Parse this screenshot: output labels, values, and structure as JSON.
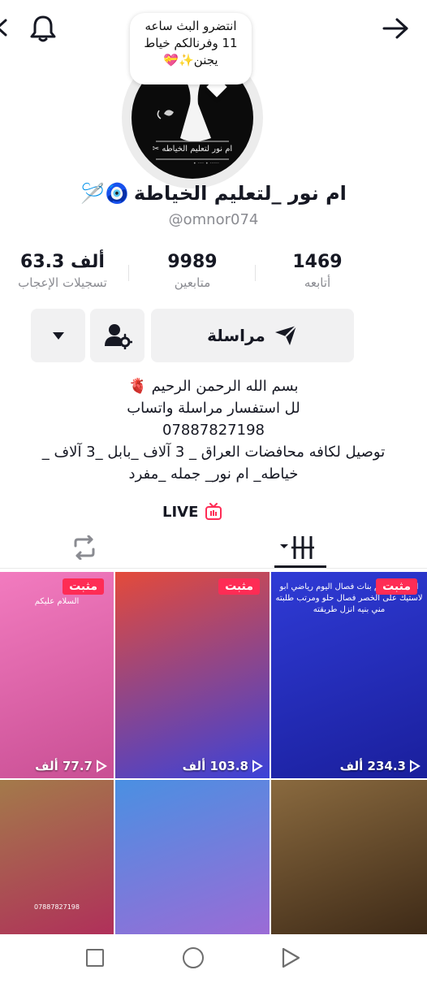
{
  "header": {
    "back_icon": "chevron-left-icon",
    "notifications_icon": "bell-icon",
    "share_icon": "arrow-right-icon"
  },
  "live_bubble": {
    "line1": "انتضرو البث ساعه",
    "line2": "11 وفرنالكم خياط",
    "line3": "يجنن✨💝"
  },
  "avatar_logo": {
    "title": "ام نور لتعليم الخياطه ✂"
  },
  "profile": {
    "name": "ام نور _لتعليم الخياطة",
    "name_emojis": "🧿🪡",
    "username": "@omnor074"
  },
  "stats": {
    "following": {
      "value": "1469",
      "label": "أتابعه"
    },
    "followers": {
      "value": "9989",
      "label": "متابعين"
    },
    "likes": {
      "value": "63.3 ألف",
      "label": "تسجيلات الإعجاب"
    }
  },
  "actions": {
    "message_label": "مراسلة",
    "message_icon": "send-icon",
    "friends_icon": "user-settings-icon",
    "more_icon": "caret-down-icon"
  },
  "bio": {
    "line1": "بسم الله الرحمن الرحيم 🫀",
    "line2": "لل استفسار مراسلة واتساب",
    "line3": "07887827198",
    "line4": "توصيل لكافه محافضات العراق _ 3 آلاف _بابل _3 آلاف _",
    "line5": "خياطه_ ام نور_ جمله _مفرد"
  },
  "live": {
    "label": "LIVE",
    "icon": "tv-icon"
  },
  "tabs": {
    "videos_icon": "grid-sort-icon",
    "reposts_icon": "repost-icon"
  },
  "videos": [
    {
      "pinned": "مثبت",
      "views": "234.3 ألف",
      "caption": "السلام عليكم بنات فصال اليوم رياضي ابو لاستيك على الخصر فصال حلو ومرتب طلبته مني بنيه انزل طريقته",
      "colors": [
        "#2f3bd6",
        "#1a1f9c"
      ]
    },
    {
      "pinned": "مثبت",
      "views": "103.8 ألف",
      "caption": "",
      "colors": [
        "#e44a3a",
        "#3b42d8"
      ]
    },
    {
      "pinned": "مثبت",
      "views": "77.7 ألف",
      "caption": "السلام عليكم",
      "colors": [
        "#f27bbf",
        "#c94f94"
      ]
    },
    {
      "pinned": "",
      "views": "",
      "caption": "",
      "colors": [
        "#8a6a3f",
        "#3e2a17"
      ]
    },
    {
      "pinned": "",
      "views": "",
      "caption": "",
      "colors": [
        "#4a90e2",
        "#9b6bd6"
      ]
    },
    {
      "pinned": "",
      "views": "",
      "caption": "07887827198",
      "colors": [
        "#a37a4a",
        "#b0305a"
      ]
    }
  ],
  "system_nav": {
    "recents_icon": "square-icon",
    "home_icon": "circle-icon",
    "back_icon": "triangle-back-icon"
  }
}
